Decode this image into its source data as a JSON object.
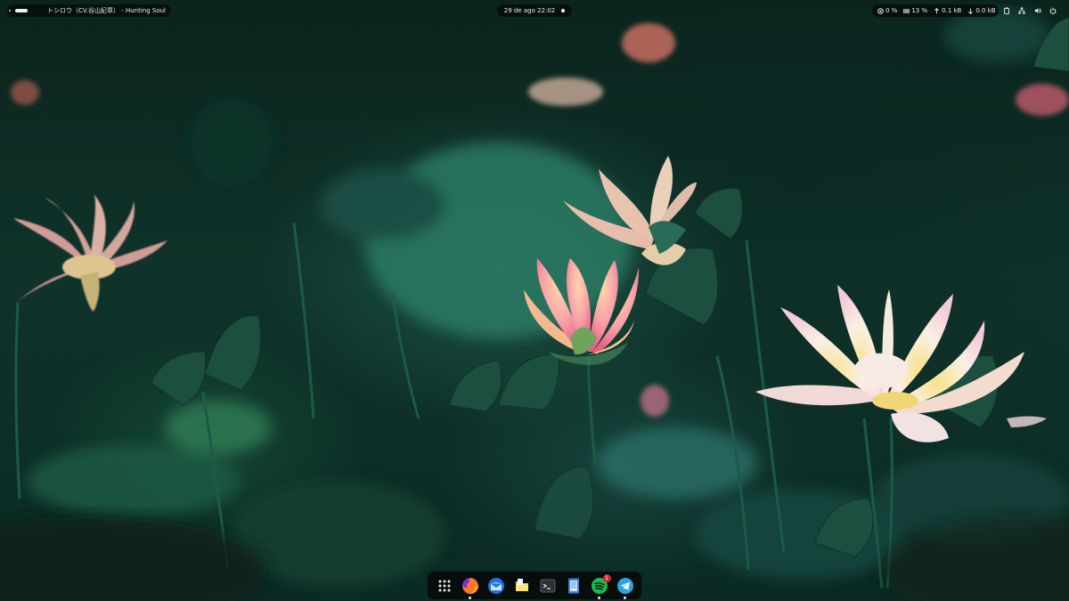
{
  "topbar": {
    "media_title": "トシロウ（CV.谷山紀章） - Hunting Soul",
    "clock": "29 de ago  22:02",
    "status": {
      "cpu": "0 %",
      "memory": "13 %",
      "upload": "0.1 kB",
      "download": "0.0 kB"
    }
  },
  "dock": {
    "items": [
      {
        "name": "app-grid",
        "icon": "app-grid-icon",
        "running": false
      },
      {
        "name": "firefox",
        "icon": "firefox-icon",
        "running": true
      },
      {
        "name": "thunderbird",
        "icon": "thunderbird-icon",
        "running": false
      },
      {
        "name": "files",
        "icon": "files-icon",
        "running": false
      },
      {
        "name": "terminal",
        "icon": "terminal-icon",
        "running": false
      },
      {
        "name": "text-editor",
        "icon": "text-editor-icon",
        "running": false
      },
      {
        "name": "spotify",
        "icon": "spotify-icon",
        "running": true,
        "badge": "1"
      },
      {
        "name": "telegram",
        "icon": "telegram-icon",
        "running": true
      }
    ]
  },
  "colors": {
    "bar_bg": "#0a0f0d",
    "badge": "#e0242a",
    "spotify": "#1db954",
    "telegram": "#2aa3de"
  }
}
